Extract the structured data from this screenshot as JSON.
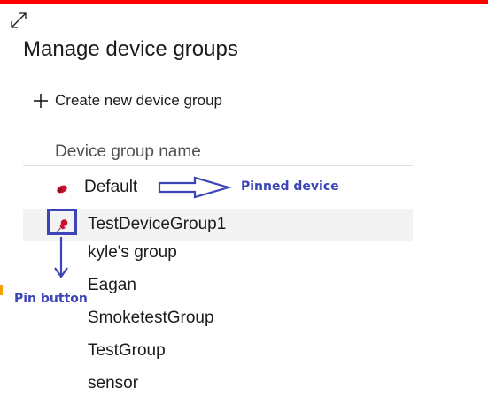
{
  "dialog": {
    "title": "Manage device groups",
    "create_label": "Create new device group",
    "column_header": "Device group name"
  },
  "rows": [
    {
      "label": "Default",
      "pinned": true
    },
    {
      "label": "TestDeviceGroup1",
      "pinned": false,
      "hover": true
    },
    {
      "label": "kyle's group",
      "pinned": false
    },
    {
      "label": "Eagan",
      "pinned": false
    },
    {
      "label": "SmoketestGroup",
      "pinned": false
    },
    {
      "label": "TestGroup",
      "pinned": false
    },
    {
      "label": "sensor",
      "pinned": false
    }
  ],
  "annotations": {
    "pinned_device": "Pinned device",
    "pin_button": "Pin button"
  },
  "colors": {
    "annotation": "#3b45b5",
    "pin": "#c8102e",
    "top_border": "#ff0000",
    "row_hover": "#f3f3f3"
  },
  "icons": {
    "expand": "expand-icon",
    "plus": "plus-icon",
    "pinned": "pinned-icon",
    "pin": "pin-icon"
  }
}
